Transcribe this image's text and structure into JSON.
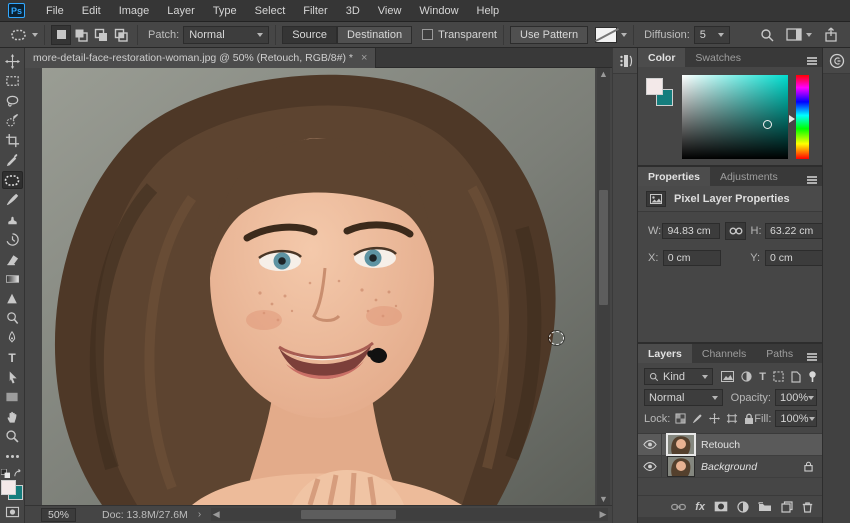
{
  "app": {
    "logo_text": "Ps"
  },
  "menu_bar": {
    "items": [
      "File",
      "Edit",
      "Image",
      "Layer",
      "Type",
      "Select",
      "Filter",
      "3D",
      "View",
      "Window",
      "Help"
    ]
  },
  "options_bar": {
    "patch_label": "Patch:",
    "patch_mode_value": "Normal",
    "source_button": "Source",
    "destination_button": "Destination",
    "transparent_checkbox": "Transparent",
    "use_pattern_button": "Use Pattern",
    "diffusion_label": "Diffusion:",
    "diffusion_value": "5"
  },
  "tools": {
    "type_glyph": "T"
  },
  "document": {
    "tab_title": "more-detail-face-restoration-woman.jpg @ 50% (Retouch, RGB/8#) *",
    "close_glyph": "×",
    "status": {
      "zoom": "50%",
      "doc_size": "Doc: 13.8M/27.6M"
    }
  },
  "color_panel": {
    "tabs": [
      "Color",
      "Swatches"
    ],
    "foreground_color": "#f3e9e9",
    "background_color": "#157d7d"
  },
  "properties_panel": {
    "tabs": [
      "Properties",
      "Adjustments"
    ],
    "header": "Pixel Layer Properties",
    "w_label": "W:",
    "w_value": "94.83 cm",
    "h_label": "H:",
    "h_value": "63.22 cm",
    "x_label": "X:",
    "x_value": "0 cm",
    "y_label": "Y:",
    "y_value": "0 cm"
  },
  "layers_panel": {
    "tabs": [
      "Layers",
      "Channels",
      "Paths"
    ],
    "kind_filter": "Kind",
    "blend_mode": "Normal",
    "opacity_label": "Opacity:",
    "opacity_value": "100%",
    "lock_label": "Lock:",
    "fill_label": "Fill:",
    "fill_value": "100%",
    "layers": [
      {
        "name": "Retouch"
      },
      {
        "name": "Background"
      }
    ],
    "fx_label": "fx"
  }
}
